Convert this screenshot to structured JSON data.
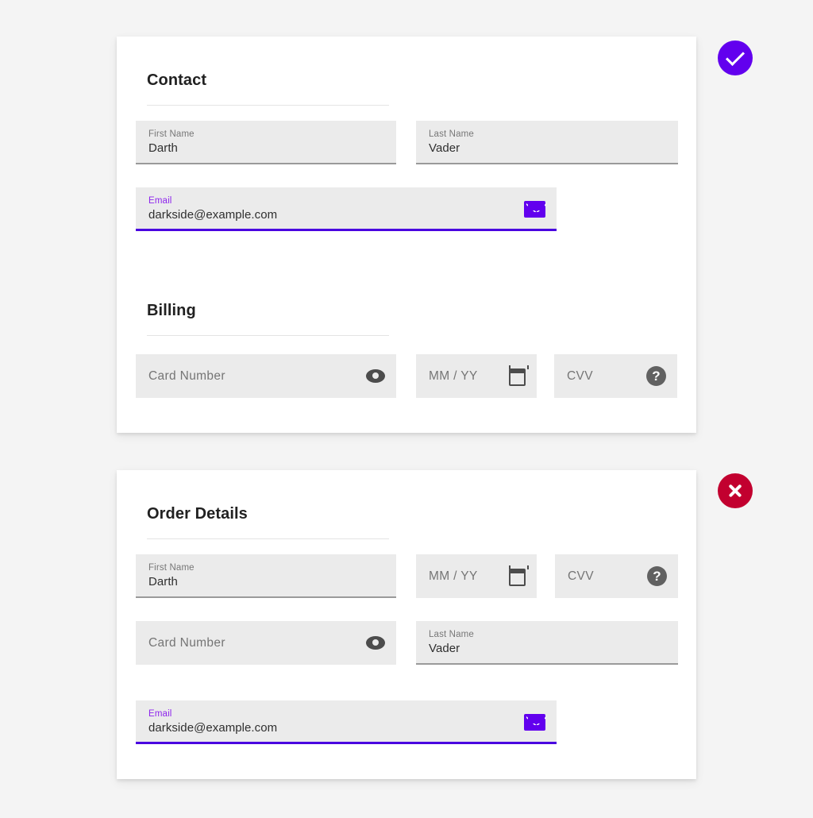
{
  "page": {
    "background_color": "#f4f4f4",
    "accent_color": "#6200ee",
    "focus_color": "#4a00e0",
    "error_color": "#c2002f"
  },
  "cards": [
    {
      "id": "contact-card",
      "sections": [
        {
          "id": "contact-section",
          "title": "Contact"
        },
        {
          "id": "billing-section",
          "title": "Billing"
        }
      ],
      "fields": [
        {
          "id": "first-name",
          "name": "first-name-field",
          "label": "First Name",
          "value": "Darth",
          "placeholder": "",
          "filled": true,
          "focused": false,
          "underline": true,
          "icon": ""
        },
        {
          "id": "last-name",
          "name": "last-name-field",
          "label": "Last Name",
          "value": "Vader",
          "placeholder": "",
          "filled": true,
          "focused": false,
          "underline": true,
          "icon": ""
        },
        {
          "id": "email",
          "name": "email-field",
          "label": "Email",
          "value": "darkside@example.com",
          "placeholder": "",
          "filled": true,
          "focused": true,
          "underline": true,
          "icon": "envelope-icon"
        },
        {
          "id": "card-number",
          "name": "card-number-field",
          "label": "",
          "value": "",
          "placeholder": "Card Number",
          "filled": false,
          "focused": false,
          "underline": false,
          "icon": "eye-icon"
        },
        {
          "id": "expiry",
          "name": "expiry-date-field",
          "label": "",
          "value": "",
          "placeholder": "MM / YY",
          "filled": false,
          "focused": false,
          "underline": false,
          "icon": "calendar-icon"
        },
        {
          "id": "cvv",
          "name": "cvv-field",
          "label": "",
          "value": "",
          "placeholder": "CVV",
          "filled": false,
          "focused": false,
          "underline": false,
          "icon": "help-icon"
        }
      ],
      "badge": {
        "type": "success",
        "icon": "check-icon",
        "color": "#6200ee"
      }
    },
    {
      "id": "order-card",
      "sections": [
        {
          "id": "order-details-section",
          "title": "Order Details"
        }
      ],
      "fields": [
        {
          "id": "first-name-2",
          "name": "first-name-field",
          "label": "First Name",
          "value": "Darth",
          "placeholder": "",
          "filled": true,
          "focused": false,
          "underline": true,
          "icon": ""
        },
        {
          "id": "expiry-2",
          "name": "expiry-date-field",
          "label": "",
          "value": "",
          "placeholder": "MM / YY",
          "filled": false,
          "focused": false,
          "underline": false,
          "icon": "calendar-icon"
        },
        {
          "id": "cvv-2",
          "name": "cvv-field",
          "label": "",
          "value": "",
          "placeholder": "CVV",
          "filled": false,
          "focused": false,
          "underline": false,
          "icon": "help-icon"
        },
        {
          "id": "card-number-2",
          "name": "card-number-field",
          "label": "",
          "value": "",
          "placeholder": "Card Number",
          "filled": false,
          "focused": false,
          "underline": false,
          "icon": "eye-icon"
        },
        {
          "id": "last-name-2",
          "name": "last-name-field",
          "label": "Last Name",
          "value": "Vader",
          "placeholder": "",
          "filled": true,
          "focused": false,
          "underline": true,
          "icon": ""
        },
        {
          "id": "email-2",
          "name": "email-field",
          "label": "Email",
          "value": "darkside@example.com",
          "placeholder": "",
          "filled": true,
          "focused": true,
          "underline": true,
          "icon": "envelope-icon"
        }
      ],
      "badge": {
        "type": "error",
        "icon": "x-icon",
        "color": "#c2002f"
      }
    }
  ],
  "icon_glyphs": {
    "help-icon": "?"
  }
}
